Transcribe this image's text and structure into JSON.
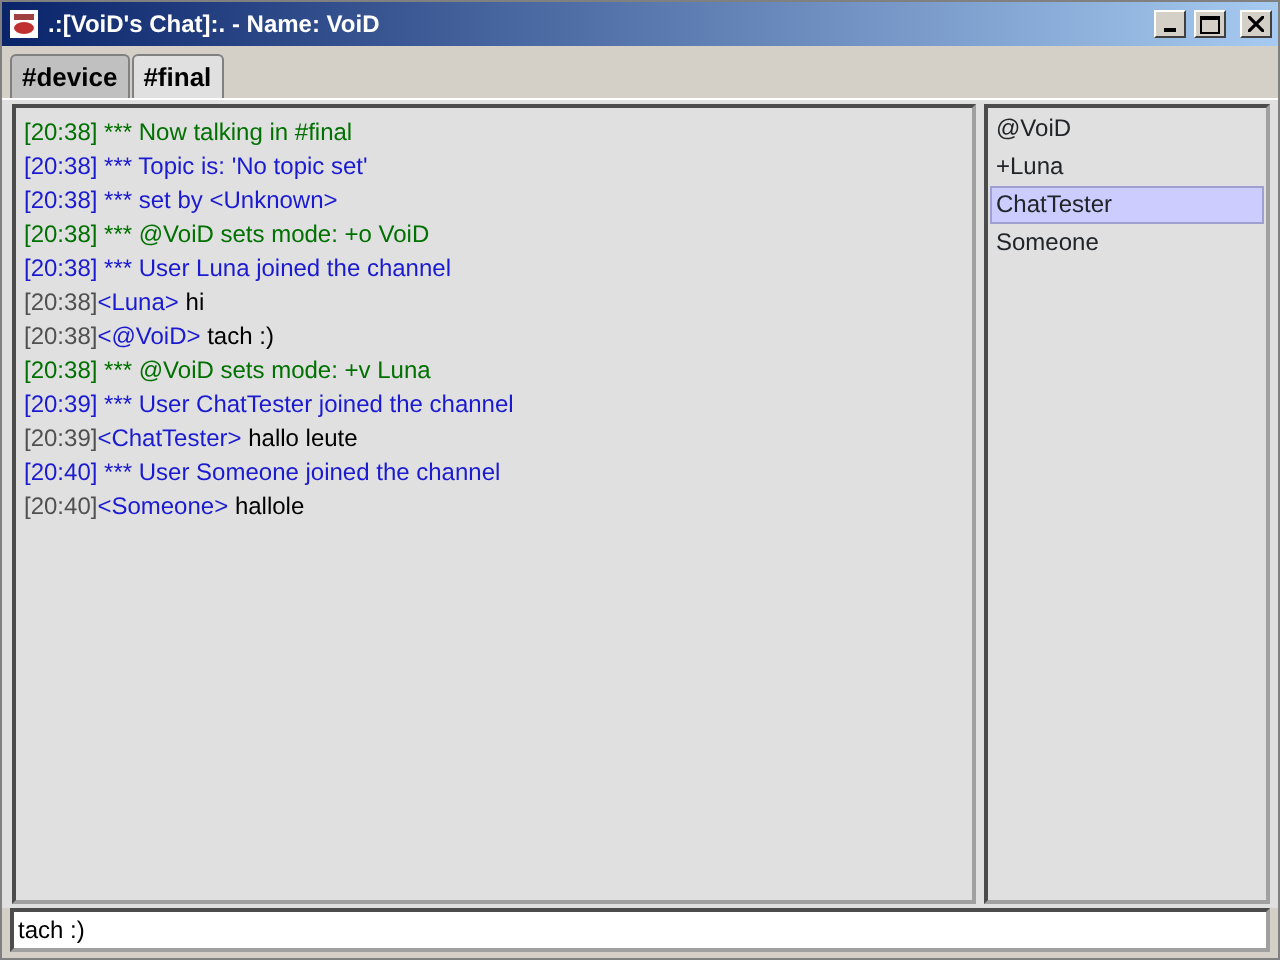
{
  "window": {
    "title": ".:[VoiD's Chat]:. - Name: VoiD"
  },
  "tabs": [
    {
      "label": "#device",
      "selected": false
    },
    {
      "label": "#final",
      "selected": true
    }
  ],
  "messages": [
    {
      "kind": "event",
      "color": "#007000",
      "text": "[20:38] *** Now talking in #final"
    },
    {
      "kind": "event",
      "color": "#1a1ad0",
      "text": "[20:38] *** Topic is: 'No topic set'"
    },
    {
      "kind": "event",
      "color": "#1a1ad0",
      "text": "[20:38] *** set by <Unknown>"
    },
    {
      "kind": "event",
      "color": "#007000",
      "text": "[20:38] *** @VoiD sets mode: +o VoiD"
    },
    {
      "kind": "event",
      "color": "#1a1ad0",
      "text": "[20:38] *** User Luna joined the channel"
    },
    {
      "kind": "chat",
      "time": "[20:38]",
      "nick": "<Luna>",
      "text": "hi"
    },
    {
      "kind": "chat",
      "time": "[20:38]",
      "nick": "<@VoiD>",
      "text": "tach :)"
    },
    {
      "kind": "event",
      "color": "#007000",
      "text": "[20:38] *** @VoiD sets mode: +v Luna"
    },
    {
      "kind": "event",
      "color": "#1a1ad0",
      "text": "[20:39] *** User ChatTester joined the channel"
    },
    {
      "kind": "chat",
      "time": "[20:39]",
      "nick": "<ChatTester>",
      "text": "hallo leute"
    },
    {
      "kind": "event",
      "color": "#1a1ad0",
      "text": "[20:40] *** User Someone joined the channel"
    },
    {
      "kind": "chat",
      "time": "[20:40]",
      "nick": "<Someone>",
      "text": "hallole"
    }
  ],
  "users": [
    {
      "name": "@VoiD",
      "selected": false
    },
    {
      "name": "+Luna",
      "selected": false
    },
    {
      "name": "ChatTester",
      "selected": true
    },
    {
      "name": "Someone",
      "selected": false
    }
  ],
  "input": {
    "value": "tach :)"
  }
}
